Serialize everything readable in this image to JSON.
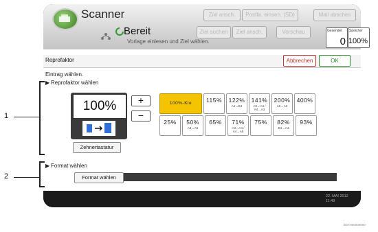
{
  "header": {
    "app_title": "Scanner",
    "function_buttons_top": [
      "Ziel ansch.",
      "Postfa. einsen. (SD)",
      "Mail absches"
    ],
    "function_buttons_mid": [
      "Ziel suchen",
      "Ziel ansch.",
      "Vorschau"
    ],
    "status": "Bereit",
    "status_sub": "Vorlage einlesen und Ziel wählen.",
    "counter_sent": {
      "label": "Gesendet",
      "value": "0"
    },
    "counter_memory": {
      "label": "Speicher",
      "value": "100%"
    }
  },
  "panel": {
    "title": "Reprofaktor",
    "cancel_label": "Abbrechen",
    "ok_label": "OK",
    "instruction": "Eintrag wählen.",
    "section1_title": "Reprofaktor wählen",
    "current_ratio": "100%",
    "plus_label": "+",
    "minus_label": "−",
    "keypad_label": "Zehnertastatur",
    "ratios_row1": [
      {
        "value": "100%-Kle",
        "sub": ""
      },
      {
        "value": "115%",
        "sub": ""
      },
      {
        "value": "122%",
        "sub": "A4→B4"
      },
      {
        "value": "141%",
        "sub": "A5→A4 / A4→A3"
      },
      {
        "value": "200%",
        "sub": "A5→A3"
      },
      {
        "value": "400%",
        "sub": ""
      }
    ],
    "ratios_row2": [
      {
        "value": "25%",
        "sub": ""
      },
      {
        "value": "50%",
        "sub": "A3→A5"
      },
      {
        "value": "65%",
        "sub": ""
      },
      {
        "value": "71%",
        "sub": "A3→A4 / A4→A5"
      },
      {
        "value": "75%",
        "sub": ""
      },
      {
        "value": "82%",
        "sub": "B4→A4"
      },
      {
        "value": "93%",
        "sub": ""
      }
    ],
    "section2_title": "Format wählen",
    "format_button": "Format wählen"
  },
  "footer": {
    "date_line1": "22. MAI 2012",
    "date_line2": "11:49"
  },
  "callouts": [
    "1",
    "2"
  ],
  "image_code": "BGT000000000"
}
